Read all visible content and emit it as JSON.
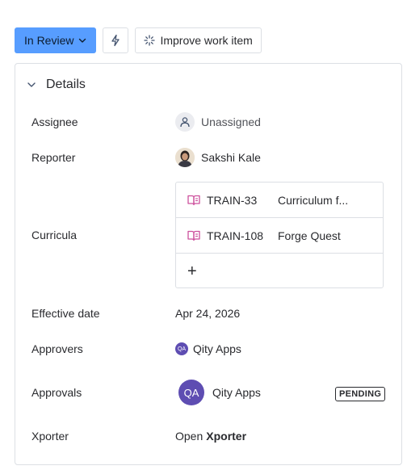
{
  "toolbar": {
    "status_label": "In Review",
    "improve_label": "Improve work item"
  },
  "details": {
    "title": "Details",
    "assignee": {
      "label": "Assignee",
      "value": "Unassigned"
    },
    "reporter": {
      "label": "Reporter",
      "value": "Sakshi Kale"
    },
    "curricula": {
      "label": "Curricula",
      "items": [
        {
          "key": "TRAIN-33",
          "title": "Curriculum f..."
        },
        {
          "key": "TRAIN-108",
          "title": "Forge Quest"
        }
      ],
      "add_symbol": "+"
    },
    "effective_date": {
      "label": "Effective date",
      "value": "Apr 24, 2026"
    },
    "approvers": {
      "label": "Approvers",
      "initials": "QA",
      "value": "Qity Apps"
    },
    "approvals": {
      "label": "Approvals",
      "initials": "QA",
      "value": "Qity Apps",
      "status": "PENDING"
    },
    "xporter": {
      "label": "Xporter",
      "prefix": "Open",
      "link": "Xporter"
    }
  },
  "colors": {
    "status_button": "#579DFF",
    "curricula_icon": "#CD519D",
    "qa_avatar": "#5E4DB2",
    "border": "#DCDFE4"
  },
  "icons": {
    "status_chevron": "chevron-down-icon",
    "automation": "lightning-bolt-icon",
    "improve": "sparkle-icon",
    "collapse": "chevron-down-icon",
    "unassigned": "person-icon",
    "curriculum": "book-icon",
    "add": "plus-icon"
  }
}
